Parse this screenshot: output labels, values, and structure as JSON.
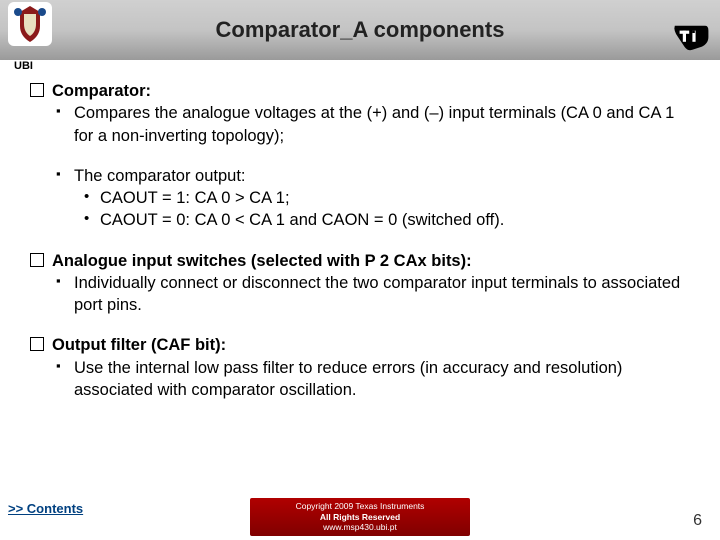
{
  "header": {
    "title": "Comparator_A components",
    "ubi": "UBI"
  },
  "sections": {
    "comparator": {
      "head": "Comparator:",
      "sub1": "Compares the analogue voltages at the (+) and (–) input terminals (CA 0 and CA 1 for a non-inverting topology);",
      "sub2": "The comparator output:",
      "b1": "CAOUT = 1: CA 0 > CA 1;",
      "b2": "CAOUT = 0: CA 0 < CA 1 and CAON = 0 (switched off)."
    },
    "switches": {
      "head": "Analogue input switches (selected with P 2 CAx bits):",
      "sub1": "Individually connect or disconnect the two comparator input terminals to associated port pins."
    },
    "filter": {
      "head": "Output filter (CAF bit):",
      "sub1": "Use the internal low pass filter to reduce errors (in accuracy and resolution) associated with comparator oscillation."
    }
  },
  "footer": {
    "contents": ">> Contents",
    "copyright_l1": "Copyright  2009 Texas Instruments",
    "copyright_l2": "All Rights Reserved",
    "url": "www.msp430.ubi.pt",
    "slide_num": "6"
  }
}
